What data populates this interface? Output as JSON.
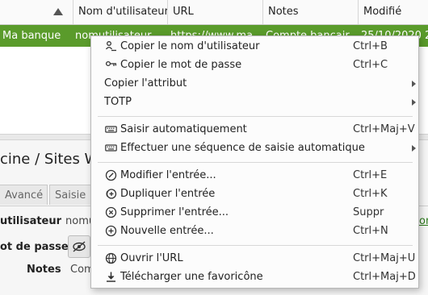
{
  "table": {
    "columns": [
      "Nom d'utilisateur",
      "URL",
      "Notes",
      "Modifié"
    ],
    "selected_row": {
      "title": "Ma banque",
      "username": "nomutilisateur",
      "url": "https://www.ma",
      "notes": "Compte bancair",
      "modified": "25/10/2020 2"
    }
  },
  "preview": {
    "path_title": "cine / Sites We",
    "tabs": [
      "Avancé",
      "Saisie"
    ],
    "fields": {
      "username_label": "utilisateur",
      "username_value": "nomu",
      "password_label": "ot de passe",
      "notes_label": "Notes",
      "notes_value": "Com"
    },
    "right_edge_link": "on"
  },
  "context_menu": {
    "items": [
      {
        "label": "Copier le nom d'utilisateur",
        "shortcut": "Ctrl+B",
        "icon": "copy-username-icon"
      },
      {
        "label": "Copier le mot de passe",
        "shortcut": "Ctrl+C",
        "icon": "copy-password-key-icon"
      },
      {
        "label": "Copier l'attribut",
        "submenu": true
      },
      {
        "label": "TOTP",
        "submenu": true
      },
      {
        "label": "Saisir automatiquement",
        "shortcut": "Ctrl+Maj+V",
        "icon": "keyboard-icon"
      },
      {
        "label": "Effectuer une séquence de saisie automatique",
        "submenu": true,
        "icon": "keyboard-icon"
      },
      {
        "label": "Modifier l'entrée...",
        "shortcut": "Ctrl+E",
        "icon": "edit-entry-icon"
      },
      {
        "label": "Dupliquer l'entrée",
        "shortcut": "Ctrl+K",
        "icon": "clone-entry-icon"
      },
      {
        "label": "Supprimer l'entrée...",
        "shortcut": "Suppr",
        "icon": "delete-entry-icon"
      },
      {
        "label": "Nouvelle entrée...",
        "shortcut": "Ctrl+N",
        "icon": "new-entry-icon"
      },
      {
        "label": "Ouvrir l'URL",
        "shortcut": "Ctrl+Maj+U",
        "icon": "globe-icon"
      },
      {
        "label": "Télécharger une favoricône",
        "shortcut": "Ctrl+Maj+D",
        "icon": "download-icon"
      }
    ]
  },
  "colors": {
    "selection": "#5a9b2b",
    "menu_bg": "#fcfcfc"
  }
}
